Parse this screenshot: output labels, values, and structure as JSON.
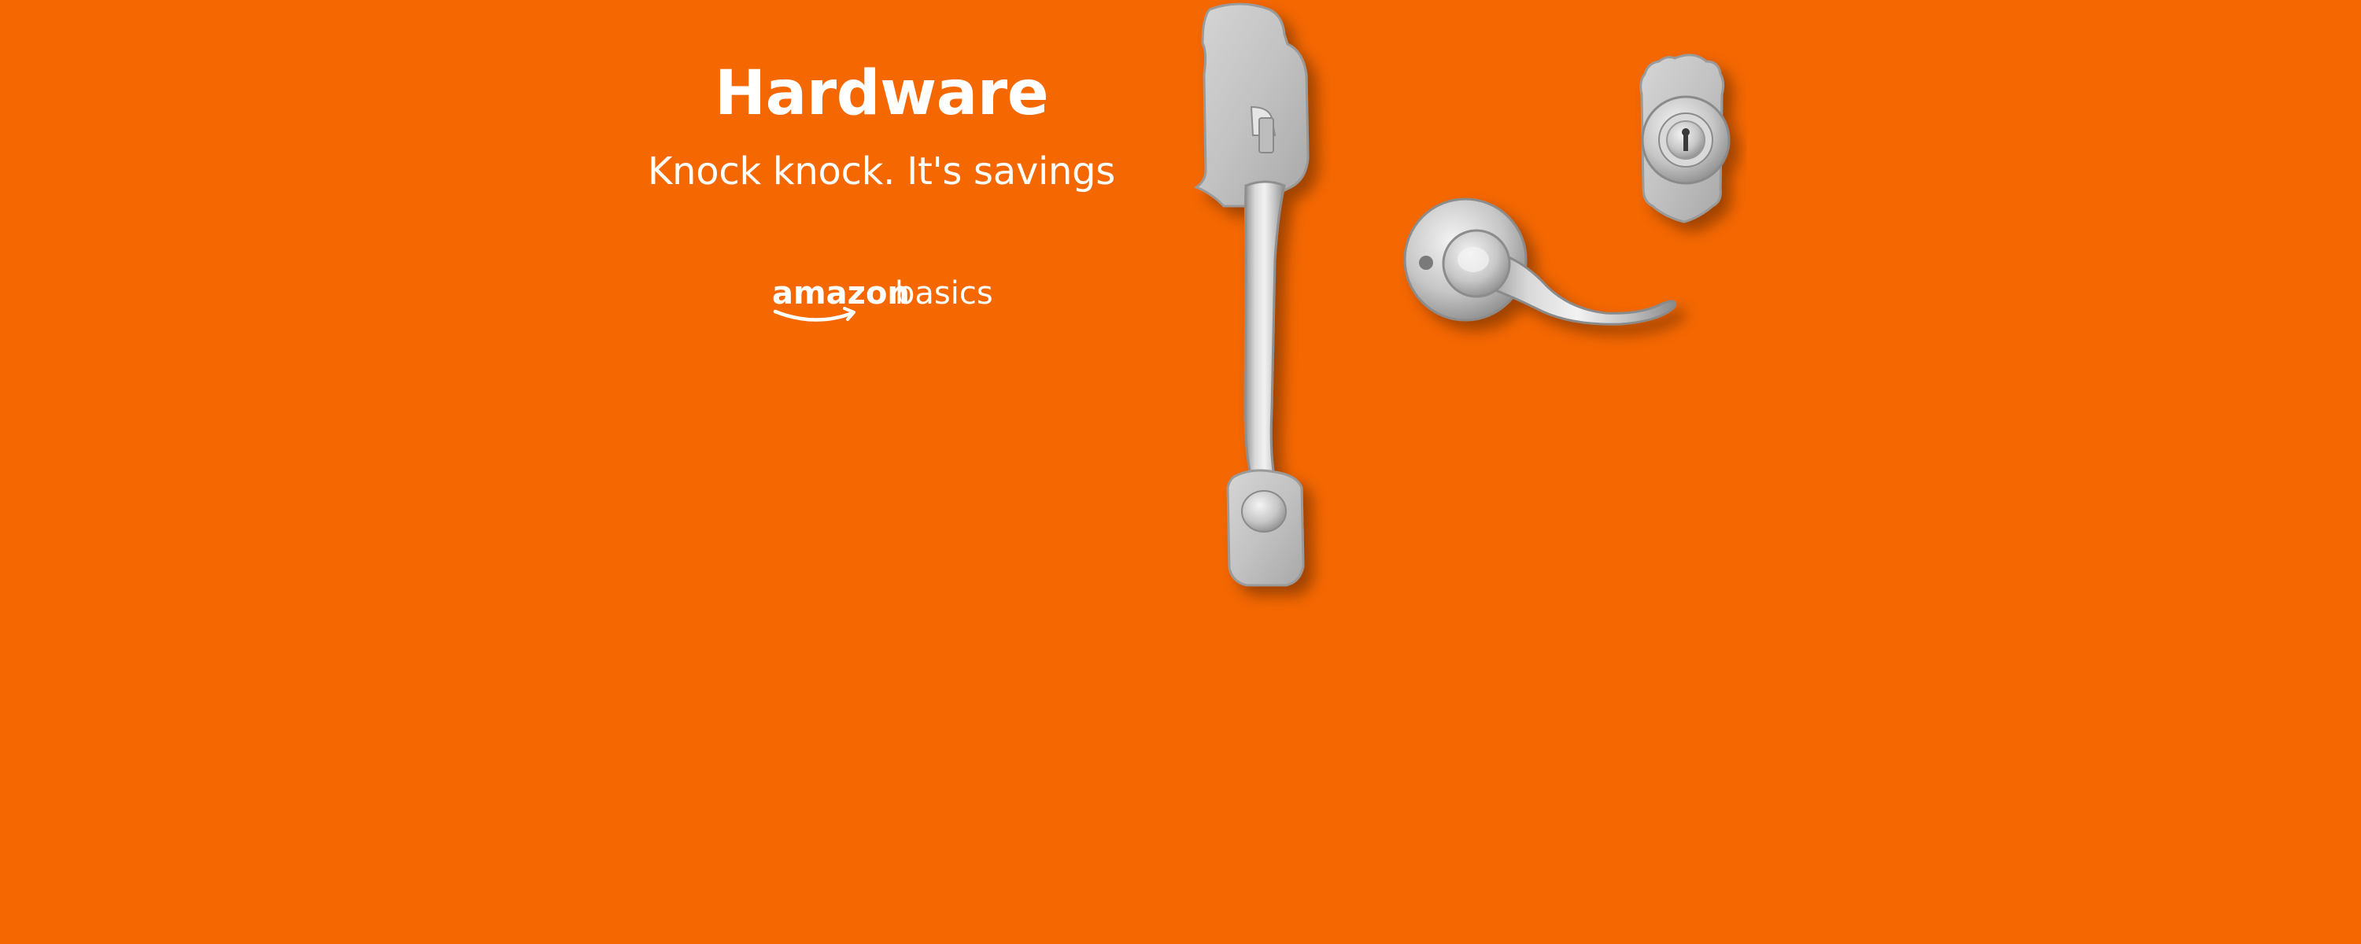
{
  "banner": {
    "headline": "Hardware",
    "subhead": "Knock knock. It's savings",
    "logo": {
      "text_amazon": "amazon",
      "text_basics": "basics",
      "color": "#ffffff"
    },
    "background_color": "#f46701",
    "product": {
      "finish_color": "#c9c9c9",
      "items": [
        "handleset",
        "lever",
        "deadbolt"
      ]
    }
  }
}
